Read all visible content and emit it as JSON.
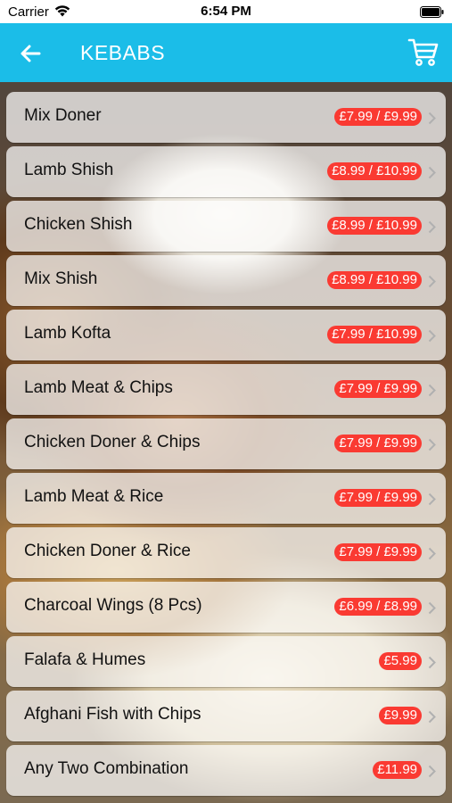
{
  "status_bar": {
    "carrier": "Carrier",
    "time": "6:54 PM"
  },
  "nav": {
    "title": "KEBABS",
    "back_icon": "arrow-left-icon",
    "cart_icon": "cart-icon"
  },
  "colors": {
    "nav_bg": "#1bbde8",
    "price_badge": "#fa3a32"
  },
  "menu": {
    "items": [
      {
        "name": "Mix Doner",
        "price": "£7.99 / £9.99"
      },
      {
        "name": "Lamb Shish",
        "price": "£8.99 / £10.99"
      },
      {
        "name": "Chicken Shish",
        "price": "£8.99 / £10.99"
      },
      {
        "name": "Mix Shish",
        "price": "£8.99 / £10.99"
      },
      {
        "name": "Lamb Kofta",
        "price": "£7.99 / £10.99"
      },
      {
        "name": "Lamb Meat & Chips",
        "price": "£7.99 / £9.99"
      },
      {
        "name": "Chicken Doner & Chips",
        "price": "£7.99 / £9.99"
      },
      {
        "name": "Lamb Meat & Rice",
        "price": "£7.99 / £9.99"
      },
      {
        "name": "Chicken Doner & Rice",
        "price": "£7.99 / £9.99"
      },
      {
        "name": "Charcoal Wings (8 Pcs)",
        "price": "£6.99 / £8.99"
      },
      {
        "name": "Falafa & Humes",
        "price": "£5.99"
      },
      {
        "name": "Afghani Fish with Chips",
        "price": "£9.99"
      },
      {
        "name": "Any Two Combination",
        "price": "£11.99"
      }
    ]
  }
}
